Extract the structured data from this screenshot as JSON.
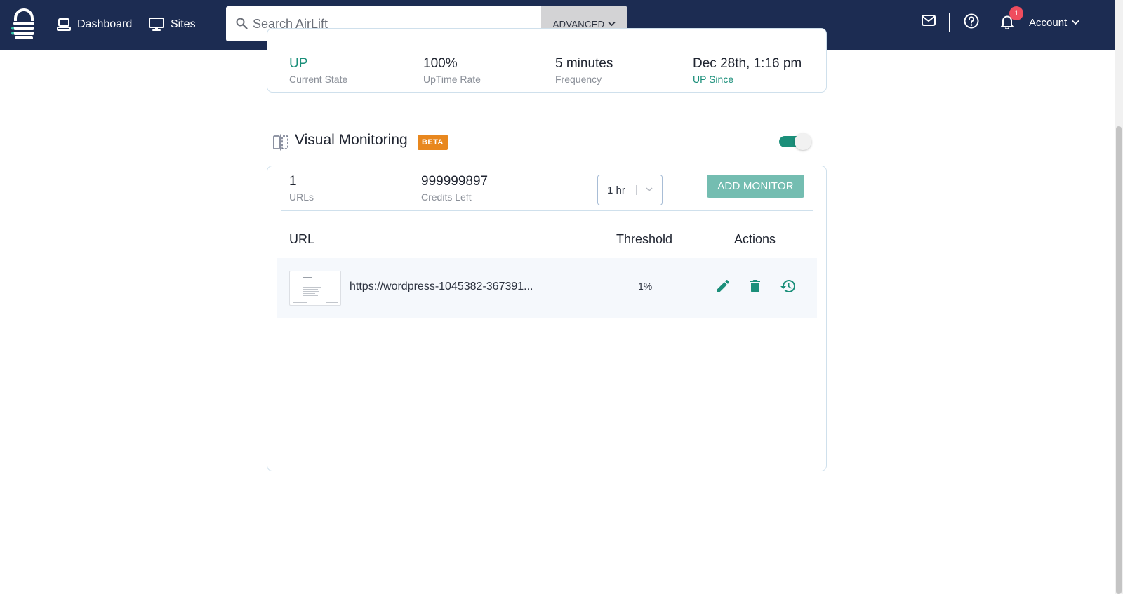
{
  "nav": {
    "dashboard_label": "Dashboard",
    "sites_label": "Sites",
    "search_placeholder": "Search AirLift",
    "advanced_label": "ADVANCED",
    "notification_count": "1",
    "account_label": "Account"
  },
  "uptime": {
    "stats": [
      {
        "value": "UP",
        "label": "Current State"
      },
      {
        "value": "100%",
        "label": "UpTime Rate"
      },
      {
        "value": "5 minutes",
        "label": "Frequency"
      },
      {
        "value": "Dec 28th, 1:16 pm",
        "label": "UP Since"
      }
    ]
  },
  "visual_monitoring": {
    "title": "Visual Monitoring",
    "badge": "BETA",
    "enabled": true,
    "urls_count": "1",
    "urls_label": "URLs",
    "credits_value": "999999897",
    "credits_label": "Credits Left",
    "period": "1 hr",
    "add_button": "ADD MONITOR",
    "table": {
      "headers": {
        "url": "URL",
        "threshold": "Threshold",
        "actions": "Actions"
      },
      "rows": [
        {
          "url": "https://wordpress-1045382-367391...",
          "threshold": "1%"
        }
      ]
    }
  },
  "colors": {
    "navbar": "#1c2c52",
    "accent": "#1b8f7a",
    "add_button": "#74bdb1",
    "badge": "#e8871e",
    "notification": "#ef4d5e"
  }
}
